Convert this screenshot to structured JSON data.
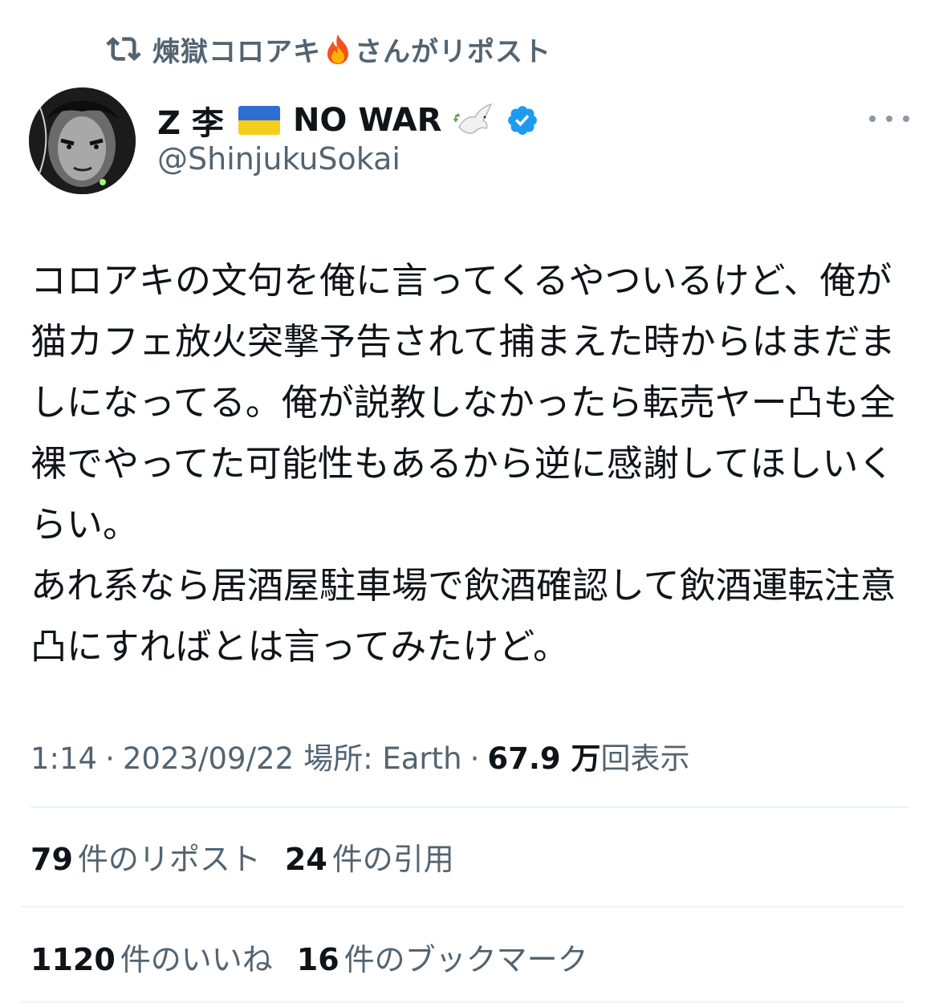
{
  "repost_banner": {
    "reposter_name": "煉獄コロアキ",
    "reposter_emoji": "fire-icon",
    "suffix": "さんがリポスト",
    "icon": "retweet-icon"
  },
  "author": {
    "display_name_prefix": "Z 李",
    "flag": "ukraine-flag-icon",
    "display_name_suffix": "NO WAR",
    "dove": "dove-icon",
    "verified": "verified-badge-icon",
    "handle": "@ShinjukuSokai",
    "avatar": "avatar"
  },
  "more_menu": "more-icon",
  "tweet": {
    "text": "コロアキの文句を俺に言ってくるやついるけど、俺が猫カフェ放火突撃予告されて捕まえた時からはまだましになってる。俺が説教しなかったら転売ヤー凸も全裸でやってた可能性もあるから逆に感謝してほしいくらい。\nあれ系なら居酒屋駐車場で飲酒確認して飲酒運転注意凸にすればとは言ってみたけど。"
  },
  "meta": {
    "time": "1:14",
    "separator": "·",
    "date": "2023/09/22",
    "location_label": "場所: Earth",
    "views_count": "67.9 万",
    "views_label": "回表示"
  },
  "stats": {
    "reposts": {
      "count": "79",
      "label": "件のリポスト"
    },
    "quotes": {
      "count": "24",
      "label": "件の引用"
    },
    "likes": {
      "count": "1120",
      "label": "件のいいね"
    },
    "bookmarks": {
      "count": "16",
      "label": "件のブックマーク"
    }
  },
  "colors": {
    "text_primary": "#0f1419",
    "text_secondary": "#536471",
    "verified_blue": "#1d9bf0",
    "divider": "#eff3f4"
  }
}
